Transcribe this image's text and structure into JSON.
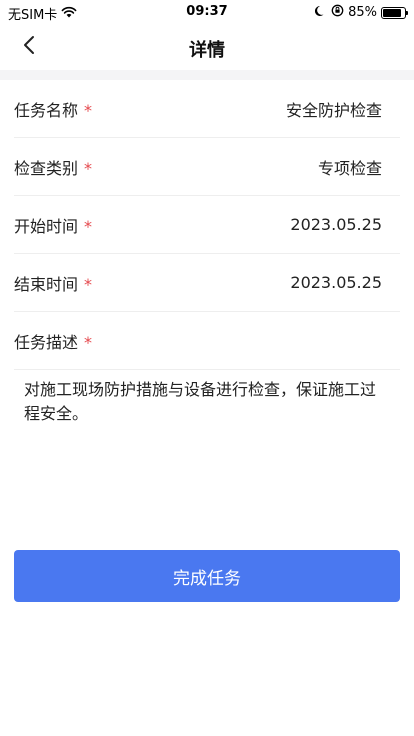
{
  "status_bar": {
    "carrier": "无SIM卡",
    "time": "09:37",
    "battery": "85%",
    "battery_level": 0.85,
    "icons": [
      "wifi-icon",
      "moon-icon",
      "orientation-lock-icon",
      "battery-icon"
    ]
  },
  "header": {
    "title": "详情",
    "back_icon": "chevron-left-icon"
  },
  "form": {
    "required_mark": "*",
    "fields": [
      {
        "label": "任务名称",
        "value": "安全防护检查"
      },
      {
        "label": "检查类别",
        "value": "专项检查"
      },
      {
        "label": "开始时间",
        "value": "2023.05.25"
      },
      {
        "label": "结束时间",
        "value": "2023.05.25"
      }
    ],
    "description_label": "任务描述",
    "description_text": "对施工现场防护措施与设备进行检查，保证施工过程安全。"
  },
  "actions": {
    "submit_label": "完成任务"
  },
  "colors": {
    "accent": "#4a78f0",
    "required": "#e5484d",
    "divider_band": "#f4f4f6"
  }
}
